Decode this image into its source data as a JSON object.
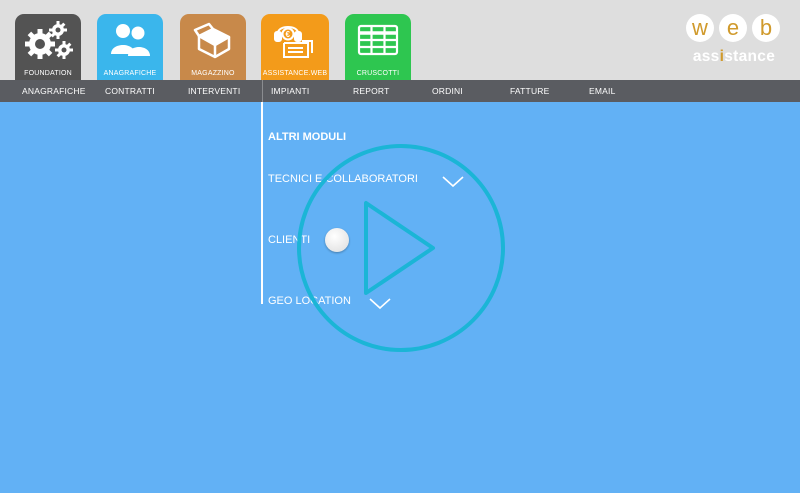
{
  "topbar": {
    "apps": [
      {
        "label": "FOUNDATION",
        "color": "#535353"
      },
      {
        "label": "ANAGRAFICHE",
        "color": "#3ab6ec"
      },
      {
        "label": "MAGAZZINO",
        "color": "#c8894a"
      },
      {
        "label": "ASSISTANCE.WEB",
        "color": "#f39b1a"
      },
      {
        "label": "CRUSCOTTI",
        "color": "#2ec650"
      }
    ]
  },
  "logo": {
    "letters": [
      "w",
      "e",
      "b"
    ],
    "word_start": "ass",
    "word_highlight": "i",
    "word_end": "stance",
    "accent_color": "#d09a2c"
  },
  "menu": {
    "items": [
      "ANAGRAFICHE",
      "CONTRATTI",
      "INTERVENTI",
      "IMPIANTI",
      "REPORT",
      "ORDINI",
      "FATTURE",
      "EMAIL"
    ]
  },
  "content": {
    "section_title": "ALTRI MODULI",
    "modules": [
      {
        "label": "TECNICI E COLLABORATORI",
        "control": "chevron-down"
      },
      {
        "label": "CLIENTI",
        "control": "toggle"
      },
      {
        "label": "GEO LOCATION",
        "control": "chevron-down"
      }
    ]
  },
  "overlay": {
    "icon": "play-icon",
    "color": "#1bb5d6"
  }
}
